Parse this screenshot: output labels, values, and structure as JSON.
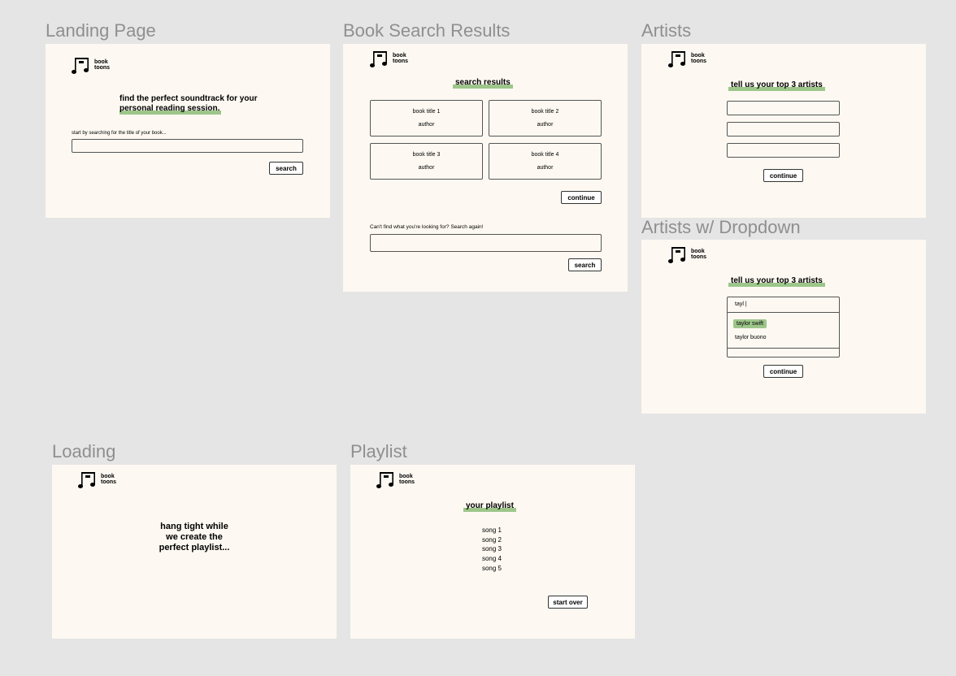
{
  "logo": {
    "line1": "book",
    "line2": "toons"
  },
  "frames": {
    "landing": {
      "label": "Landing Page",
      "heading_line1": "find the perfect soundtrack for your",
      "heading_line2": "personal reading session.",
      "prompt": "start by searching for the title of your book...",
      "search_value": "",
      "search_button": "search"
    },
    "results": {
      "label": "Book Search Results",
      "heading": "search results",
      "books": [
        {
          "title": "book title 1",
          "author": "author"
        },
        {
          "title": "book title 2",
          "author": "author"
        },
        {
          "title": "book title 3",
          "author": "author"
        },
        {
          "title": "book title 4",
          "author": "author"
        }
      ],
      "continue_button": "continue",
      "search_again_prompt": "Can't find what you're looking for? Search again!",
      "search_button": "search"
    },
    "artists": {
      "label": "Artists",
      "heading": "tell us your top 3 artists",
      "continue_button": "continue"
    },
    "artists_dropdown": {
      "label": "Artists w/ Dropdown",
      "heading": "tell us your top 3 artists",
      "input_value": "tayl |",
      "options": [
        "taylor swift",
        "taylor buono"
      ],
      "continue_button": "continue"
    },
    "loading": {
      "label": "Loading",
      "line1": "hang tight while",
      "line2": "we create the",
      "line3": "perfect playlist..."
    },
    "playlist": {
      "label": "Playlist",
      "heading": "your playlist",
      "songs": [
        "song 1",
        "song 2",
        "song 3",
        "song 4",
        "song 5"
      ],
      "start_over_button": "start over"
    }
  },
  "colors": {
    "canvas": "#e5e5e5",
    "frame": "#fdf9f2",
    "highlight": "#9dc68a",
    "label": "#8f8f8f"
  },
  "icons": {
    "logo": "music-notes-icon"
  }
}
